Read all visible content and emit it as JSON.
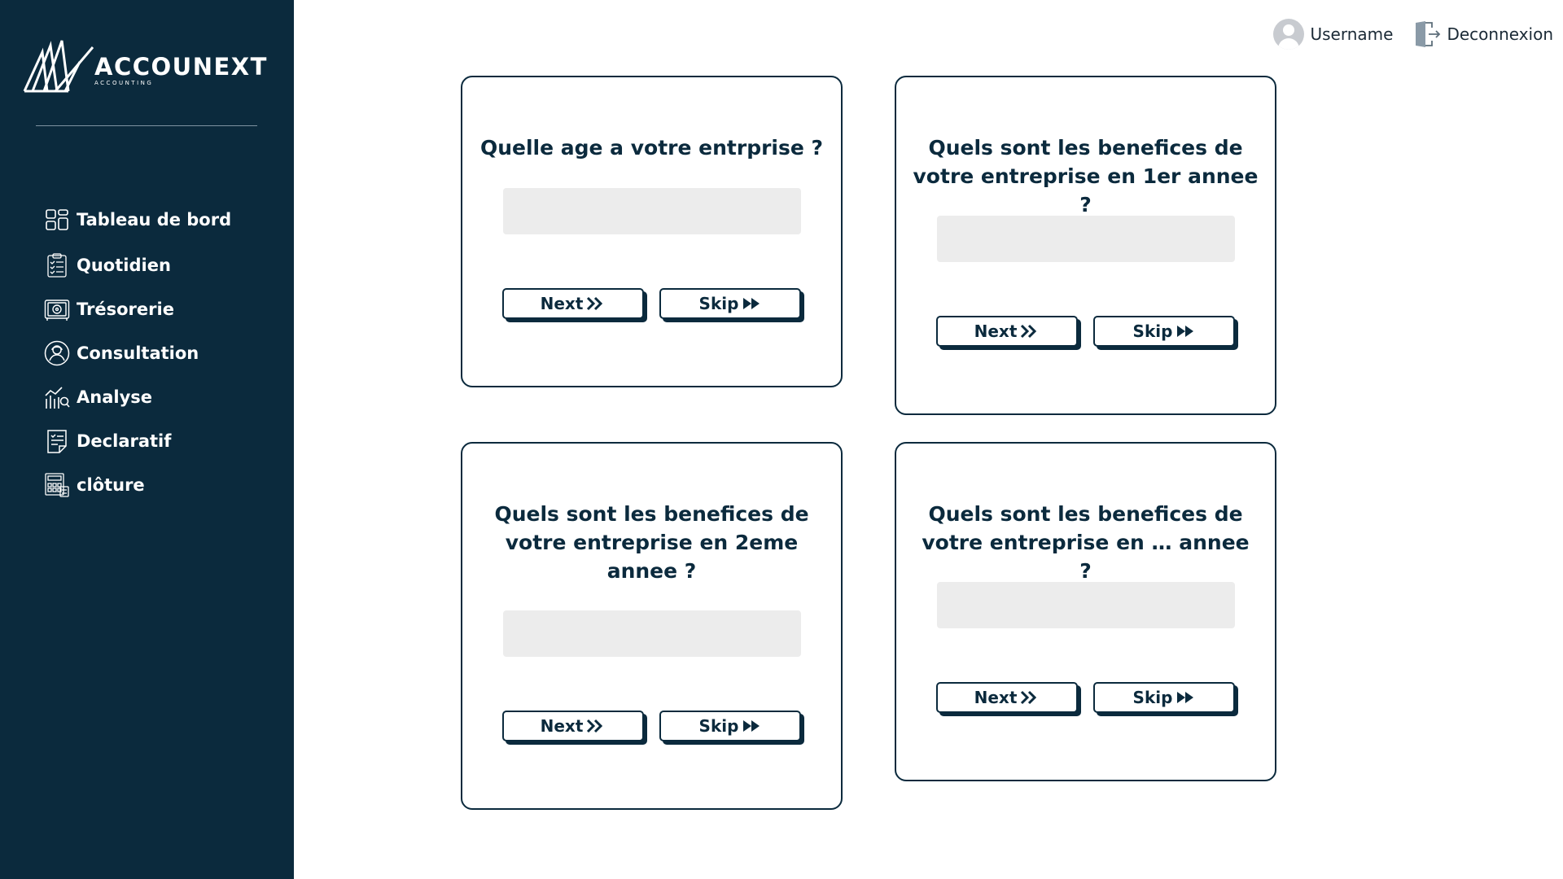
{
  "app": {
    "brand_name": "ACCOUNEXT",
    "brand_tagline": "ACCOUNTING",
    "colors": {
      "sidebar": "#0b2a3d",
      "accent": "#0b2a3d",
      "input_bg": "#ececec"
    }
  },
  "sidebar": {
    "items": [
      {
        "label": "Tableau de bord",
        "icon": "dashboard-icon"
      },
      {
        "label": "Quotidien",
        "icon": "clipboard-list-icon"
      },
      {
        "label": "Trésorerie",
        "icon": "safe-icon"
      },
      {
        "label": "Consultation",
        "icon": "user-circle-icon"
      },
      {
        "label": "Analyse",
        "icon": "chart-search-icon"
      },
      {
        "label": "Declaratif",
        "icon": "document-check-icon"
      },
      {
        "label": "clôture",
        "icon": "calculator-icon"
      }
    ]
  },
  "topbar": {
    "username": "Username",
    "logout_label": "Deconnexion"
  },
  "cards": [
    {
      "question": "Quelle age a votre entrprise ?",
      "answer_value": "",
      "next_label": "Next",
      "skip_label": "Skip"
    },
    {
      "question": "Quels sont les benefices de votre entreprise en 1er annee ?",
      "answer_value": "",
      "next_label": "Next",
      "skip_label": "Skip"
    },
    {
      "question": "Quels sont les benefices de votre entreprise en 2eme annee ?",
      "answer_value": "",
      "next_label": "Next",
      "skip_label": "Skip"
    },
    {
      "question": "Quels sont les benefices de votre entreprise en … annee ?",
      "answer_value": "",
      "next_label": "Next",
      "skip_label": "Skip"
    }
  ]
}
